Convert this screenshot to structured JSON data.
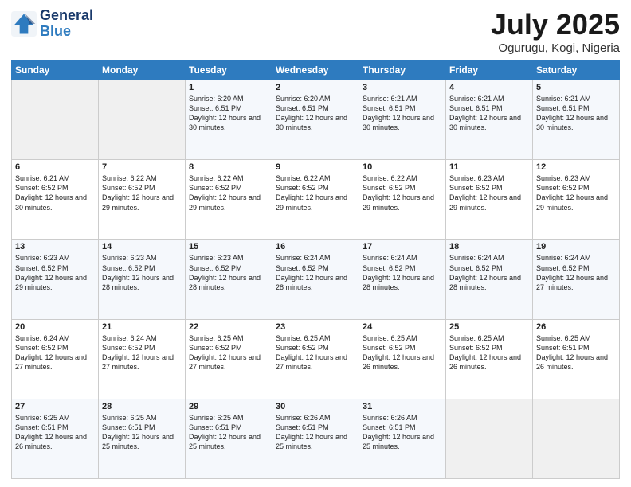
{
  "logo": {
    "general": "General",
    "blue": "Blue"
  },
  "title": "July 2025",
  "subtitle": "Ogurugu, Kogi, Nigeria",
  "headers": [
    "Sunday",
    "Monday",
    "Tuesday",
    "Wednesday",
    "Thursday",
    "Friday",
    "Saturday"
  ],
  "weeks": [
    [
      {
        "day": "",
        "sunrise": "",
        "sunset": "",
        "daylight": ""
      },
      {
        "day": "",
        "sunrise": "",
        "sunset": "",
        "daylight": ""
      },
      {
        "day": "1",
        "sunrise": "Sunrise: 6:20 AM",
        "sunset": "Sunset: 6:51 PM",
        "daylight": "Daylight: 12 hours and 30 minutes."
      },
      {
        "day": "2",
        "sunrise": "Sunrise: 6:20 AM",
        "sunset": "Sunset: 6:51 PM",
        "daylight": "Daylight: 12 hours and 30 minutes."
      },
      {
        "day": "3",
        "sunrise": "Sunrise: 6:21 AM",
        "sunset": "Sunset: 6:51 PM",
        "daylight": "Daylight: 12 hours and 30 minutes."
      },
      {
        "day": "4",
        "sunrise": "Sunrise: 6:21 AM",
        "sunset": "Sunset: 6:51 PM",
        "daylight": "Daylight: 12 hours and 30 minutes."
      },
      {
        "day": "5",
        "sunrise": "Sunrise: 6:21 AM",
        "sunset": "Sunset: 6:51 PM",
        "daylight": "Daylight: 12 hours and 30 minutes."
      }
    ],
    [
      {
        "day": "6",
        "sunrise": "Sunrise: 6:21 AM",
        "sunset": "Sunset: 6:52 PM",
        "daylight": "Daylight: 12 hours and 30 minutes."
      },
      {
        "day": "7",
        "sunrise": "Sunrise: 6:22 AM",
        "sunset": "Sunset: 6:52 PM",
        "daylight": "Daylight: 12 hours and 29 minutes."
      },
      {
        "day": "8",
        "sunrise": "Sunrise: 6:22 AM",
        "sunset": "Sunset: 6:52 PM",
        "daylight": "Daylight: 12 hours and 29 minutes."
      },
      {
        "day": "9",
        "sunrise": "Sunrise: 6:22 AM",
        "sunset": "Sunset: 6:52 PM",
        "daylight": "Daylight: 12 hours and 29 minutes."
      },
      {
        "day": "10",
        "sunrise": "Sunrise: 6:22 AM",
        "sunset": "Sunset: 6:52 PM",
        "daylight": "Daylight: 12 hours and 29 minutes."
      },
      {
        "day": "11",
        "sunrise": "Sunrise: 6:23 AM",
        "sunset": "Sunset: 6:52 PM",
        "daylight": "Daylight: 12 hours and 29 minutes."
      },
      {
        "day": "12",
        "sunrise": "Sunrise: 6:23 AM",
        "sunset": "Sunset: 6:52 PM",
        "daylight": "Daylight: 12 hours and 29 minutes."
      }
    ],
    [
      {
        "day": "13",
        "sunrise": "Sunrise: 6:23 AM",
        "sunset": "Sunset: 6:52 PM",
        "daylight": "Daylight: 12 hours and 29 minutes."
      },
      {
        "day": "14",
        "sunrise": "Sunrise: 6:23 AM",
        "sunset": "Sunset: 6:52 PM",
        "daylight": "Daylight: 12 hours and 28 minutes."
      },
      {
        "day": "15",
        "sunrise": "Sunrise: 6:23 AM",
        "sunset": "Sunset: 6:52 PM",
        "daylight": "Daylight: 12 hours and 28 minutes."
      },
      {
        "day": "16",
        "sunrise": "Sunrise: 6:24 AM",
        "sunset": "Sunset: 6:52 PM",
        "daylight": "Daylight: 12 hours and 28 minutes."
      },
      {
        "day": "17",
        "sunrise": "Sunrise: 6:24 AM",
        "sunset": "Sunset: 6:52 PM",
        "daylight": "Daylight: 12 hours and 28 minutes."
      },
      {
        "day": "18",
        "sunrise": "Sunrise: 6:24 AM",
        "sunset": "Sunset: 6:52 PM",
        "daylight": "Daylight: 12 hours and 28 minutes."
      },
      {
        "day": "19",
        "sunrise": "Sunrise: 6:24 AM",
        "sunset": "Sunset: 6:52 PM",
        "daylight": "Daylight: 12 hours and 27 minutes."
      }
    ],
    [
      {
        "day": "20",
        "sunrise": "Sunrise: 6:24 AM",
        "sunset": "Sunset: 6:52 PM",
        "daylight": "Daylight: 12 hours and 27 minutes."
      },
      {
        "day": "21",
        "sunrise": "Sunrise: 6:24 AM",
        "sunset": "Sunset: 6:52 PM",
        "daylight": "Daylight: 12 hours and 27 minutes."
      },
      {
        "day": "22",
        "sunrise": "Sunrise: 6:25 AM",
        "sunset": "Sunset: 6:52 PM",
        "daylight": "Daylight: 12 hours and 27 minutes."
      },
      {
        "day": "23",
        "sunrise": "Sunrise: 6:25 AM",
        "sunset": "Sunset: 6:52 PM",
        "daylight": "Daylight: 12 hours and 27 minutes."
      },
      {
        "day": "24",
        "sunrise": "Sunrise: 6:25 AM",
        "sunset": "Sunset: 6:52 PM",
        "daylight": "Daylight: 12 hours and 26 minutes."
      },
      {
        "day": "25",
        "sunrise": "Sunrise: 6:25 AM",
        "sunset": "Sunset: 6:52 PM",
        "daylight": "Daylight: 12 hours and 26 minutes."
      },
      {
        "day": "26",
        "sunrise": "Sunrise: 6:25 AM",
        "sunset": "Sunset: 6:51 PM",
        "daylight": "Daylight: 12 hours and 26 minutes."
      }
    ],
    [
      {
        "day": "27",
        "sunrise": "Sunrise: 6:25 AM",
        "sunset": "Sunset: 6:51 PM",
        "daylight": "Daylight: 12 hours and 26 minutes."
      },
      {
        "day": "28",
        "sunrise": "Sunrise: 6:25 AM",
        "sunset": "Sunset: 6:51 PM",
        "daylight": "Daylight: 12 hours and 25 minutes."
      },
      {
        "day": "29",
        "sunrise": "Sunrise: 6:25 AM",
        "sunset": "Sunset: 6:51 PM",
        "daylight": "Daylight: 12 hours and 25 minutes."
      },
      {
        "day": "30",
        "sunrise": "Sunrise: 6:26 AM",
        "sunset": "Sunset: 6:51 PM",
        "daylight": "Daylight: 12 hours and 25 minutes."
      },
      {
        "day": "31",
        "sunrise": "Sunrise: 6:26 AM",
        "sunset": "Sunset: 6:51 PM",
        "daylight": "Daylight: 12 hours and 25 minutes."
      },
      {
        "day": "",
        "sunrise": "",
        "sunset": "",
        "daylight": ""
      },
      {
        "day": "",
        "sunrise": "",
        "sunset": "",
        "daylight": ""
      }
    ]
  ]
}
